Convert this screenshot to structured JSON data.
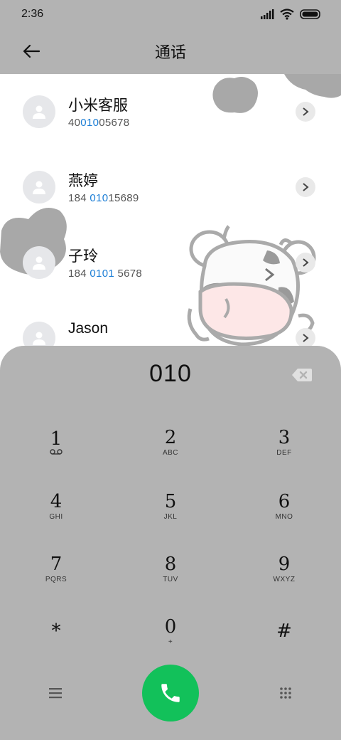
{
  "status_bar": {
    "time": "2:36"
  },
  "header": {
    "title": "通话"
  },
  "contacts": [
    {
      "name": "小米客服",
      "number_parts": [
        "40",
        "010",
        "05678"
      ]
    },
    {
      "name": "燕婷",
      "number_parts": [
        "184 ",
        "010",
        "15689"
      ]
    },
    {
      "name": "子玲",
      "number_parts": [
        "184 ",
        "0101",
        " 5678"
      ]
    },
    {
      "name": "Jason",
      "number_parts": [
        "",
        "",
        ""
      ]
    }
  ],
  "dialpad": {
    "input": "010",
    "keys": [
      {
        "digit": "1",
        "letters": ""
      },
      {
        "digit": "2",
        "letters": "ABC"
      },
      {
        "digit": "3",
        "letters": "DEF"
      },
      {
        "digit": "4",
        "letters": "GHI"
      },
      {
        "digit": "5",
        "letters": "JKL"
      },
      {
        "digit": "6",
        "letters": "MNO"
      },
      {
        "digit": "7",
        "letters": "PQRS"
      },
      {
        "digit": "8",
        "letters": "TUV"
      },
      {
        "digit": "9",
        "letters": "WXYZ"
      },
      {
        "digit": "*",
        "letters": ""
      },
      {
        "digit": "0",
        "letters": "+"
      },
      {
        "digit": "#",
        "letters": ""
      }
    ]
  },
  "colors": {
    "accent": "#1c7ed6",
    "call": "#12c15a",
    "panel": "#b3b3b3"
  }
}
